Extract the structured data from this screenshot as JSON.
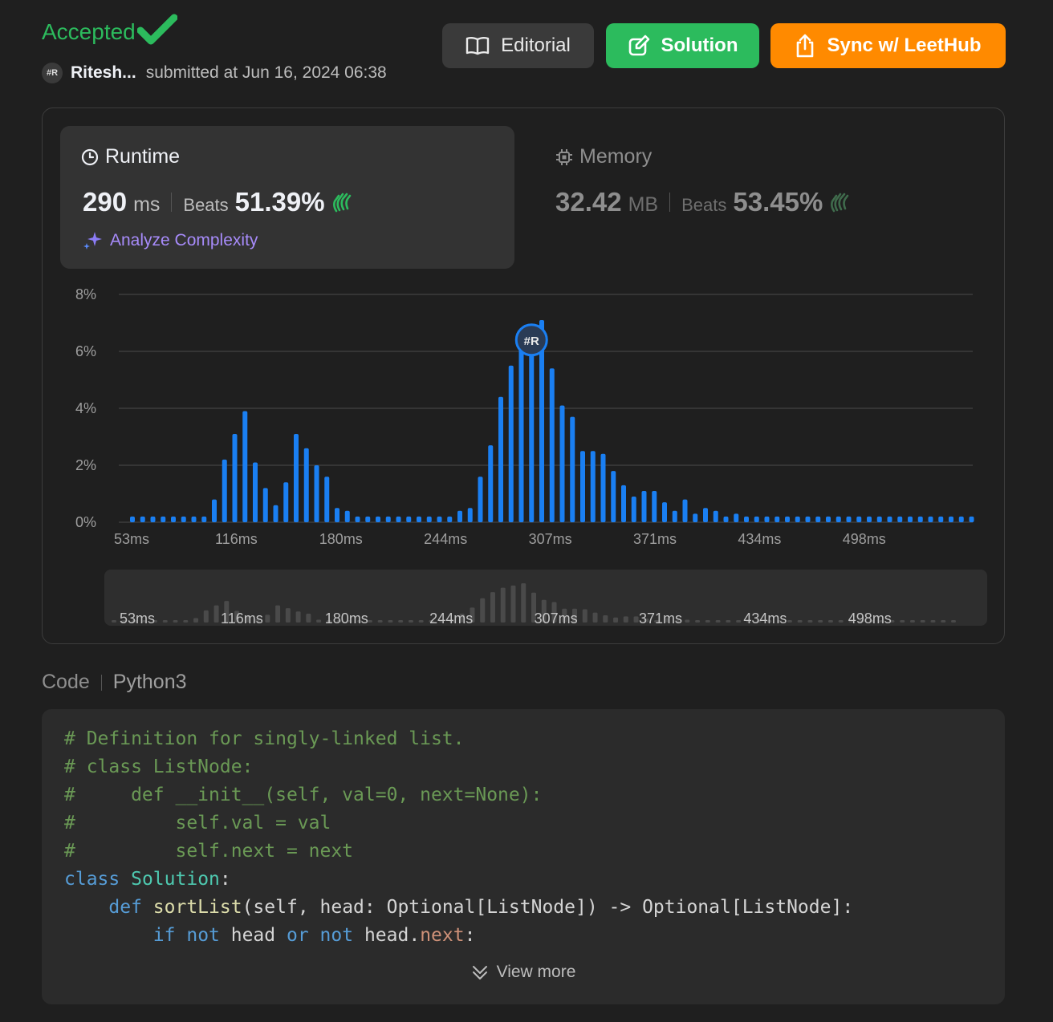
{
  "status": "Accepted",
  "user": {
    "avatar_text": "#R",
    "name": "Ritesh...",
    "submitted": "submitted at Jun 16, 2024 06:38"
  },
  "buttons": {
    "editorial": "Editorial",
    "solution": "Solution",
    "sync": "Sync w/ LeetHub"
  },
  "runtime": {
    "title": "Runtime",
    "value": "290",
    "unit": "ms",
    "beats_label": "Beats",
    "beats": "51.39%",
    "analyze": "Analyze Complexity"
  },
  "memory": {
    "title": "Memory",
    "value": "32.42",
    "unit": "MB",
    "beats_label": "Beats",
    "beats": "53.45%"
  },
  "colors": {
    "accepted": "#2cbb5d",
    "solution_btn": "#2cbb5d",
    "sync_btn": "#ff8a00",
    "bar": "#1a7ff2",
    "analyze": "#a78bfa"
  },
  "chart_data": {
    "type": "bar",
    "ylabel_ticks": [
      "0%",
      "2%",
      "4%",
      "6%",
      "8%"
    ],
    "ylim": [
      0,
      8
    ],
    "x_tick_labels": [
      "53ms",
      "116ms",
      "180ms",
      "244ms",
      "307ms",
      "371ms",
      "434ms",
      "498ms"
    ],
    "marker_label": "#R",
    "marker_bar_index": 39,
    "values": [
      0.2,
      0.2,
      0.2,
      0.2,
      0.2,
      0.2,
      0.2,
      0.2,
      0.8,
      2.2,
      3.1,
      3.9,
      2.1,
      1.2,
      0.6,
      1.4,
      3.1,
      2.6,
      2.0,
      1.6,
      0.5,
      0.4,
      0.2,
      0.2,
      0.2,
      0.2,
      0.2,
      0.2,
      0.2,
      0.2,
      0.2,
      0.2,
      0.4,
      0.5,
      1.6,
      2.7,
      4.4,
      5.5,
      6.3,
      6.7,
      7.1,
      5.4,
      4.1,
      3.7,
      2.5,
      2.5,
      2.4,
      1.8,
      1.3,
      0.9,
      1.1,
      1.1,
      0.7,
      0.4,
      0.8,
      0.3,
      0.5,
      0.4,
      0.2,
      0.3,
      0.2,
      0.2,
      0.2,
      0.2,
      0.2,
      0.2,
      0.2,
      0.2,
      0.2,
      0.2,
      0.2,
      0.2,
      0.2,
      0.2,
      0.2,
      0.2,
      0.2,
      0.2,
      0.2,
      0.2,
      0.2,
      0.2,
      0.2
    ],
    "grid": true
  },
  "code": {
    "label": "Code",
    "language": "Python3",
    "view_more": "View more"
  }
}
